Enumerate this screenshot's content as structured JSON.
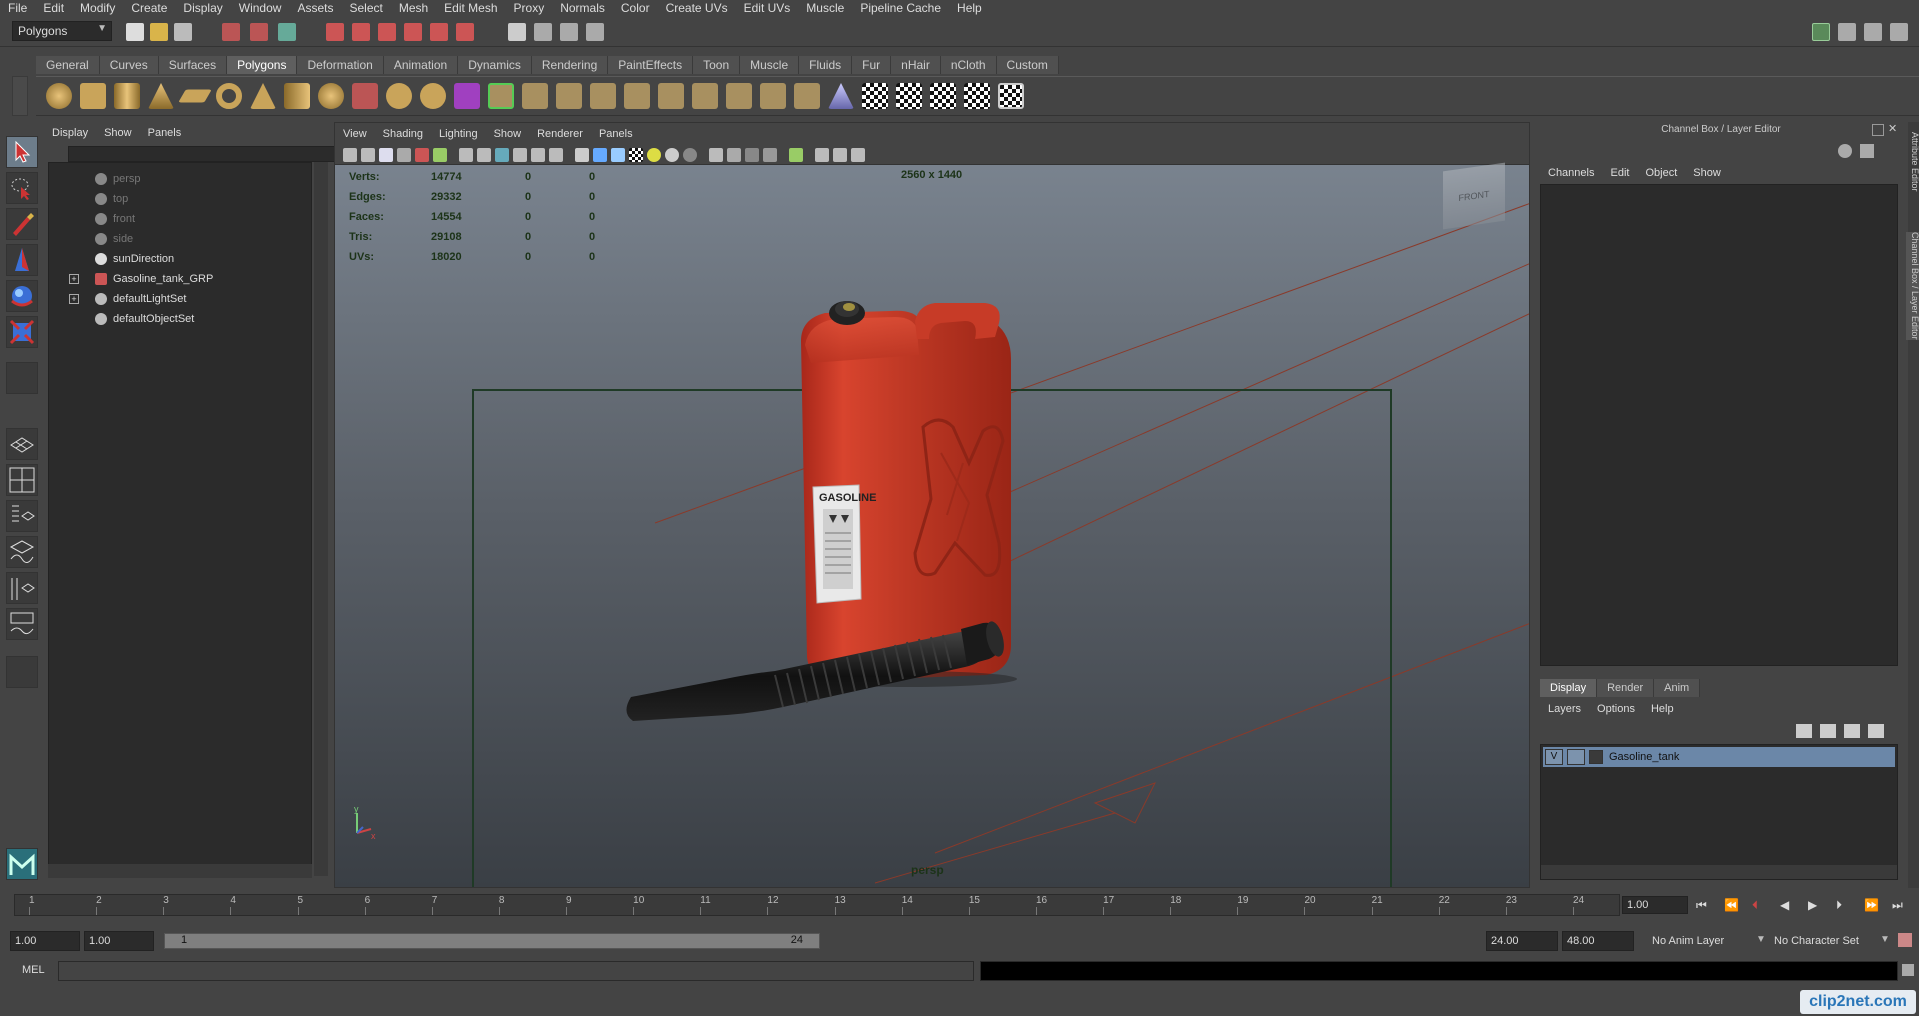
{
  "menubar": {
    "items": [
      "File",
      "Edit",
      "Modify",
      "Create",
      "Display",
      "Window",
      "Assets",
      "Select",
      "Mesh",
      "Edit Mesh",
      "Proxy",
      "Normals",
      "Color",
      "Create UVs",
      "Edit UVs",
      "Muscle",
      "Pipeline Cache",
      "Help"
    ]
  },
  "status": {
    "mode": "Polygons"
  },
  "shelf": {
    "tabs": [
      "General",
      "Curves",
      "Surfaces",
      "Polygons",
      "Deformation",
      "Animation",
      "Dynamics",
      "Rendering",
      "PaintEffects",
      "Toon",
      "Muscle",
      "Fluids",
      "Fur",
      "nHair",
      "nCloth",
      "Custom"
    ],
    "active_tab": "Polygons"
  },
  "outliner": {
    "menu": [
      "Display",
      "Show",
      "Panels"
    ],
    "items": [
      {
        "label": "persp",
        "dim": true
      },
      {
        "label": "top",
        "dim": true
      },
      {
        "label": "front",
        "dim": true
      },
      {
        "label": "side",
        "dim": true
      },
      {
        "label": "sunDirection",
        "dim": false
      },
      {
        "label": "Gasoline_tank_GRP",
        "dim": false,
        "expandable": true
      },
      {
        "label": "defaultLightSet",
        "dim": false,
        "expandable": true
      },
      {
        "label": "defaultObjectSet",
        "dim": false
      }
    ],
    "expand_symbol": "+"
  },
  "viewport": {
    "menu": [
      "View",
      "Shading",
      "Lighting",
      "Show",
      "Renderer",
      "Panels"
    ],
    "hud": {
      "rows": [
        {
          "label": "Verts:",
          "v1": "14774",
          "v2": "0",
          "v3": "0"
        },
        {
          "label": "Edges:",
          "v1": "29332",
          "v2": "0",
          "v3": "0"
        },
        {
          "label": "Faces:",
          "v1": "14554",
          "v2": "0",
          "v3": "0"
        },
        {
          "label": "Tris:",
          "v1": "29108",
          "v2": "0",
          "v3": "0"
        },
        {
          "label": "UVs:",
          "v1": "18020",
          "v2": "0",
          "v3": "0"
        }
      ]
    },
    "resolution": "2560 x 1440",
    "camera_name": "persp",
    "viewcube_label": "FRONT",
    "product_label": "GASOLINE",
    "axis_x": "x",
    "axis_y": "y"
  },
  "channelbox": {
    "title": "Channel Box / Layer Editor",
    "menu": [
      "Channels",
      "Edit",
      "Object",
      "Show"
    ],
    "layer_tabs": [
      "Display",
      "Render",
      "Anim"
    ],
    "active_layer_tab": "Display",
    "layer_menu": [
      "Layers",
      "Options",
      "Help"
    ],
    "layer": {
      "visible": "V",
      "name": "Gasoline_tank"
    },
    "side_tabs": [
      "Attribute Editor",
      "Channel Box / Layer Editor"
    ]
  },
  "timeline": {
    "ticks": [
      "1",
      "2",
      "3",
      "4",
      "5",
      "6",
      "7",
      "8",
      "9",
      "10",
      "11",
      "12",
      "13",
      "14",
      "15",
      "16",
      "17",
      "18",
      "19",
      "20",
      "21",
      "22",
      "23",
      "24"
    ],
    "current_frame": "1.00"
  },
  "range": {
    "start": "1.00",
    "playback_start": "1.00",
    "bar_start": "1",
    "bar_end": "24",
    "playback_end": "24.00",
    "end": "48.00",
    "anim_layer": "No Anim Layer",
    "char_set": "No Character Set"
  },
  "command": {
    "label": "MEL"
  },
  "watermark": "clip2net.com",
  "colors": {
    "accent_red": "#c0392b",
    "layer_blue": "#6b87a8",
    "hud_text": "#1c3318"
  }
}
